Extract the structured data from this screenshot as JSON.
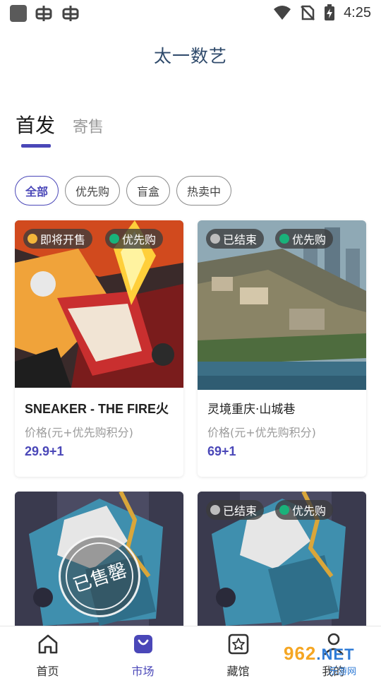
{
  "status_bar": {
    "time": "4:25"
  },
  "app": {
    "title": "太一数艺"
  },
  "tabs": [
    {
      "label": "首发",
      "active": true
    },
    {
      "label": "寄售",
      "active": false
    }
  ],
  "filters": [
    {
      "label": "全部",
      "active": true
    },
    {
      "label": "优先购",
      "active": false
    },
    {
      "label": "盲盒",
      "active": false
    },
    {
      "label": "热卖中",
      "active": false
    }
  ],
  "cards": [
    {
      "status": "即将开售",
      "tag": "优先购",
      "name": "SNEAKER - THE FIRE火",
      "price_label": "价格(元+优先购积分)",
      "price": "29.9+1"
    },
    {
      "status": "已结束",
      "tag": "优先购",
      "name": "灵境重庆·山城巷",
      "price_label": "价格(元+优先购积分)",
      "price": "69+1"
    },
    {
      "stamp": "已售罄"
    },
    {
      "status": "已结束",
      "tag": "优先购"
    }
  ],
  "bottom_nav": [
    {
      "label": "首页",
      "icon": "home-icon"
    },
    {
      "label": "市场",
      "icon": "bag-icon",
      "active": true
    },
    {
      "label": "藏馆",
      "icon": "star-box-icon"
    },
    {
      "label": "我的",
      "icon": "user-icon"
    }
  ],
  "watermark": {
    "brand": "962",
    "net": ".NET",
    "sub": "乐游网"
  },
  "colors": {
    "accent": "#4a47b8",
    "title": "#2f4a6b",
    "green_dot": "#19b27a",
    "clock": "#f3b63a"
  }
}
